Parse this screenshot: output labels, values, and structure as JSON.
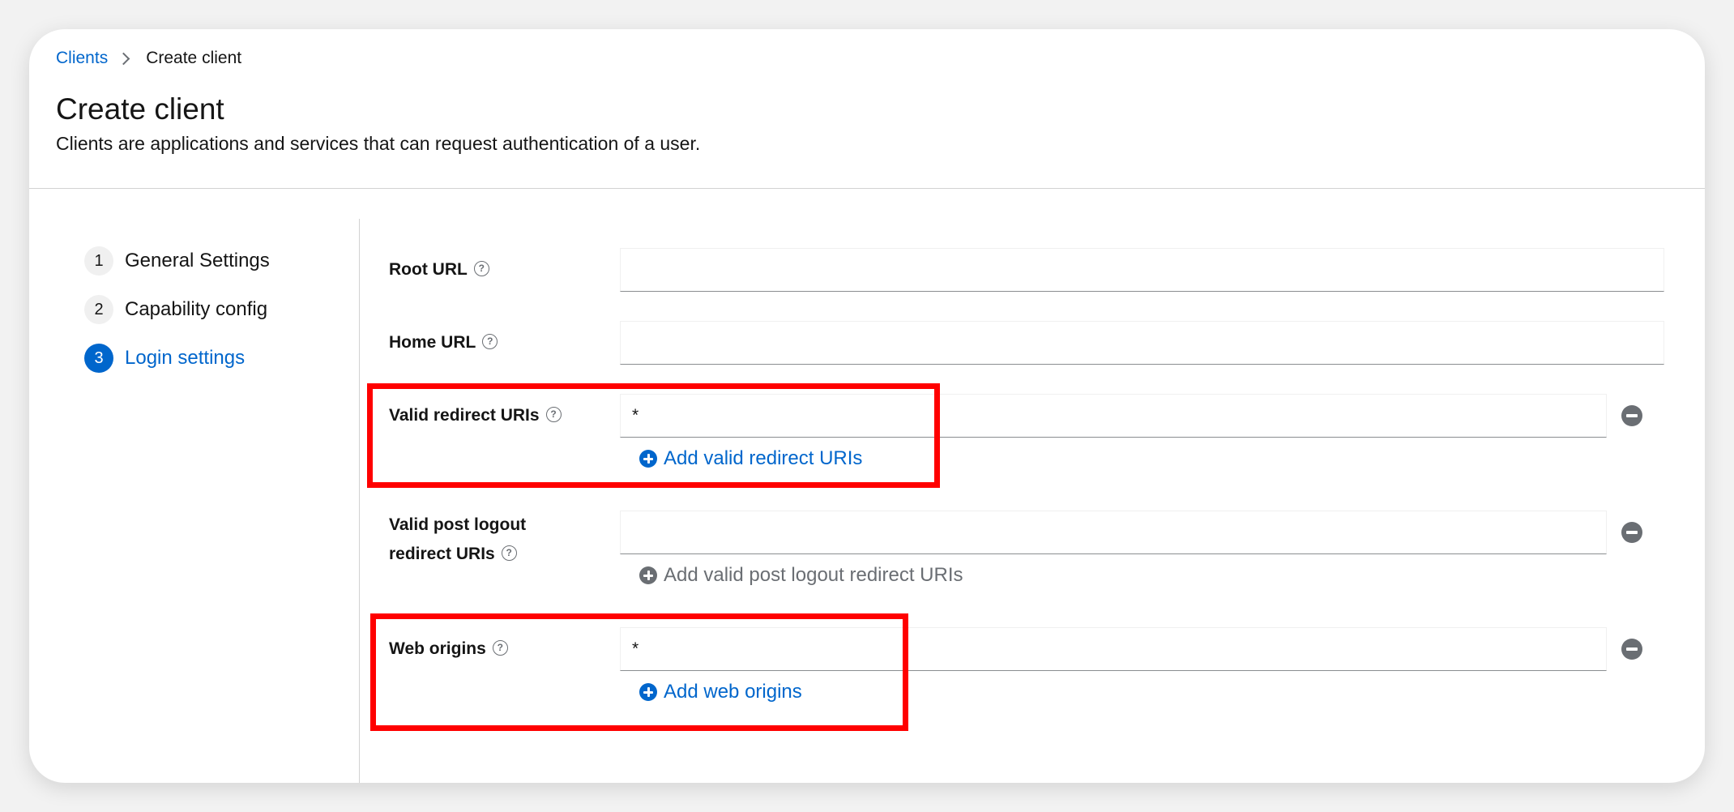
{
  "breadcrumb": {
    "parent": "Clients",
    "current": "Create client"
  },
  "page": {
    "title": "Create client",
    "description": "Clients are applications and services that can request authentication of a user."
  },
  "wizard": {
    "steps": [
      {
        "number": "1",
        "label": "General Settings",
        "active": false
      },
      {
        "number": "2",
        "label": "Capability config",
        "active": false
      },
      {
        "number": "3",
        "label": "Login settings",
        "active": true
      }
    ]
  },
  "form": {
    "root_url": {
      "label": "Root URL",
      "value": ""
    },
    "home_url": {
      "label": "Home URL",
      "value": ""
    },
    "valid_redirect_uris": {
      "label": "Valid redirect URIs",
      "value": "*",
      "add_label": "Add valid redirect URIs"
    },
    "valid_post_logout": {
      "label_line1": "Valid post logout",
      "label_line2": "redirect URIs",
      "value": "",
      "add_label": "Add valid post logout redirect URIs"
    },
    "web_origins": {
      "label": "Web origins",
      "value": "*",
      "add_label": "Add web origins"
    }
  },
  "icons": {
    "help": "question-circle-icon",
    "remove": "minus-circle-icon",
    "add": "plus-circle-icon"
  },
  "colors": {
    "link": "#0066cc",
    "highlight": "#ff0000",
    "muted": "#6a6e73"
  }
}
